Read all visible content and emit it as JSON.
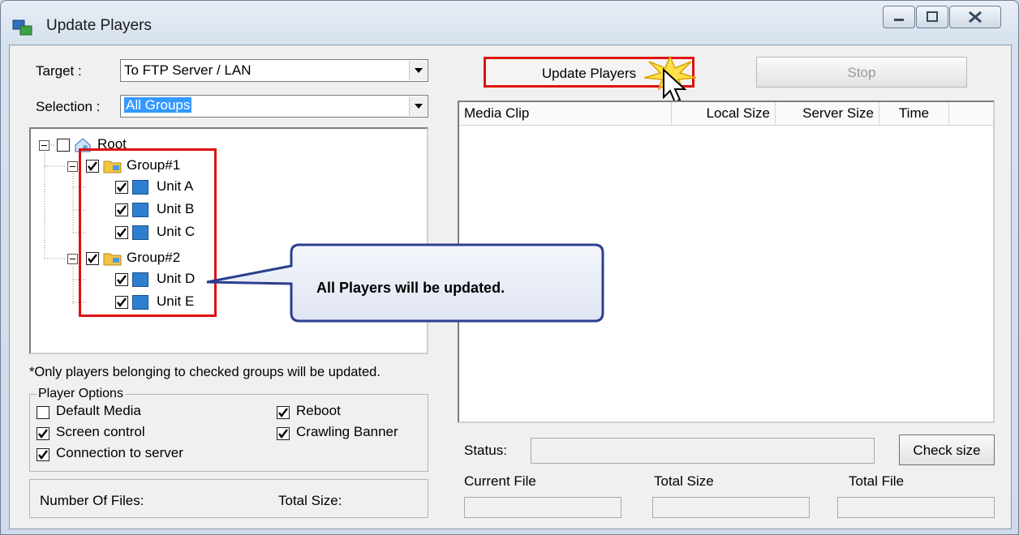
{
  "window": {
    "title": "Update Players"
  },
  "target": {
    "label": "Target :",
    "value": "To FTP Server / LAN"
  },
  "selection": {
    "label": "Selection :",
    "value": "All Groups"
  },
  "tree": {
    "root": "Root",
    "groups": [
      {
        "label": "Group#1",
        "units": [
          "Unit A",
          "Unit B",
          "Unit C"
        ]
      },
      {
        "label": "Group#2",
        "units": [
          "Unit D",
          "Unit E"
        ]
      }
    ]
  },
  "note": "*Only players belonging to checked groups will be updated.",
  "player_options": {
    "legend": "Player Options",
    "default_media": "Default Media",
    "screen_control": "Screen control",
    "connection_to_server": "Connection to server",
    "reboot": "Reboot",
    "crawling_banner": "Crawling Banner"
  },
  "summary": {
    "number_of_files": "Number Of Files:",
    "total_size": "Total Size:"
  },
  "buttons": {
    "update_players": "Update Players",
    "stop": "Stop",
    "check_size": "Check size"
  },
  "media_table": {
    "columns": [
      "Media Clip",
      "Local Size",
      "Server Size",
      "Time"
    ]
  },
  "status": {
    "label": "Status:"
  },
  "progress": {
    "current_file": "Current File",
    "total_size": "Total Size",
    "total_file": "Total File"
  },
  "callout": {
    "text": "All Players will be updated."
  },
  "colors": {
    "highlight_box": "#e01010",
    "selection": "#3399ff",
    "callout_border": "#2b3f8f"
  }
}
